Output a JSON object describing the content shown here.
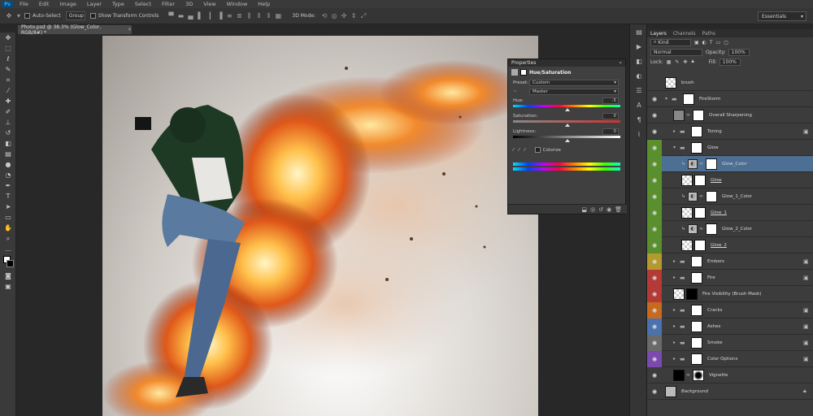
{
  "app": {
    "logo": "Ps"
  },
  "menu": [
    "File",
    "Edit",
    "Image",
    "Layer",
    "Type",
    "Select",
    "Filter",
    "3D",
    "View",
    "Window",
    "Help"
  ],
  "options": {
    "auto_select": "Auto-Select",
    "group": "Group",
    "show_transform": "Show Transform Controls",
    "mode_3d": "3D Mode:",
    "workspace": "Essentials"
  },
  "document": {
    "tab_title": "Photo.psd @ 38.3% (Glow_Color, RGB/8#) *",
    "close": "×"
  },
  "tools": [
    "move-icon",
    "marquee-icon",
    "lasso-icon",
    "quick-select-icon",
    "crop-icon",
    "eyedropper-icon",
    "healing-icon",
    "brush-icon",
    "stamp-icon",
    "history-brush-icon",
    "eraser-icon",
    "gradient-icon",
    "blur-icon",
    "dodge-icon",
    "pen-icon",
    "type-icon",
    "path-select-icon",
    "shape-icon",
    "hand-icon",
    "zoom-icon"
  ],
  "layers_panel": {
    "tabs": [
      "Layers",
      "Channels",
      "Paths"
    ],
    "kind": "Kind",
    "blend": "Normal",
    "opacity_label": "Opacity:",
    "opacity": "100%",
    "lock_label": "Lock:",
    "fill_label": "Fill:",
    "fill": "100%",
    "layers": [
      {
        "name": "brush",
        "type": "check",
        "color": "none",
        "indent": 0
      },
      {
        "name": "FireStorm",
        "type": "group",
        "color": "none",
        "indent": 0
      },
      {
        "name": "Overall Sharpening",
        "type": "gray",
        "color": "none",
        "indent": 1
      },
      {
        "name": "Toning",
        "type": "group",
        "color": "none",
        "indent": 1
      },
      {
        "name": "Glow",
        "type": "group",
        "color": "green",
        "indent": 1
      },
      {
        "name": "Glow_Color",
        "type": "adj",
        "color": "green",
        "indent": 2,
        "selected": true
      },
      {
        "name": "Glow",
        "type": "check",
        "color": "green",
        "indent": 2
      },
      {
        "name": "Glow_1_Color",
        "type": "adj",
        "color": "green",
        "indent": 2
      },
      {
        "name": "Glow_1",
        "type": "check",
        "color": "green",
        "indent": 2
      },
      {
        "name": "Glow_2_Color",
        "type": "adj",
        "color": "green",
        "indent": 2
      },
      {
        "name": "Glow_2",
        "type": "check",
        "color": "green",
        "indent": 2
      },
      {
        "name": "Embers",
        "type": "group",
        "color": "yellow",
        "indent": 1
      },
      {
        "name": "Fire",
        "type": "group",
        "color": "red",
        "indent": 1
      },
      {
        "name": "Fire Visibility (Brush Mask)",
        "type": "mask",
        "color": "red",
        "indent": 1
      },
      {
        "name": "Cracks",
        "type": "group",
        "color": "orange",
        "indent": 1
      },
      {
        "name": "Ashes",
        "type": "group",
        "color": "blue",
        "indent": 1
      },
      {
        "name": "Smoke",
        "type": "group",
        "color": "gray",
        "indent": 1
      },
      {
        "name": "Color Options",
        "type": "group",
        "color": "violet",
        "indent": 1
      },
      {
        "name": "Vignette",
        "type": "vignette",
        "color": "none",
        "indent": 1
      },
      {
        "name": "Background",
        "type": "bg",
        "color": "none",
        "indent": 0
      }
    ]
  },
  "properties": {
    "tab": "Properties",
    "close": "»",
    "title": "Hue/Saturation",
    "preset_label": "Preset:",
    "preset": "Custom",
    "channel": "Master",
    "hue_label": "Hue:",
    "hue": "-5",
    "sat_label": "Saturation:",
    "sat": "0",
    "light_label": "Lightness:",
    "light": "0",
    "colorize": "Colorize"
  },
  "colors": {
    "green": "#5a8f2e",
    "yellow": "#b49a2a",
    "red": "#b43a36",
    "orange": "#c86a1e",
    "blue": "#4a72b0",
    "gray": "#6a6a6a",
    "violet": "#7a4ab0",
    "selected": "#4d6f94"
  }
}
